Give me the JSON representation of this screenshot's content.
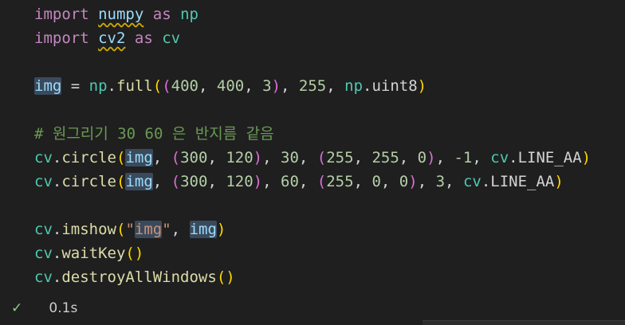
{
  "cell": {
    "lines": [
      [
        [
          "import",
          "kw"
        ],
        [
          " ",
          "op"
        ],
        [
          "numpy",
          "var sq"
        ],
        [
          " ",
          "op"
        ],
        [
          "as",
          "kw"
        ],
        [
          " ",
          "op"
        ],
        [
          "np",
          "mod"
        ]
      ],
      [
        [
          "import",
          "kw"
        ],
        [
          " ",
          "op"
        ],
        [
          "cv2",
          "var sq"
        ],
        [
          " ",
          "op"
        ],
        [
          "as",
          "kw"
        ],
        [
          " ",
          "op"
        ],
        [
          "cv",
          "mod"
        ]
      ],
      [],
      [
        [
          "img",
          "var hl"
        ],
        [
          " = ",
          "op"
        ],
        [
          "np",
          "mod"
        ],
        [
          ".",
          "op"
        ],
        [
          "full",
          "fn"
        ],
        [
          "(",
          "br-gold"
        ],
        [
          "(",
          "br-pink"
        ],
        [
          "400",
          "num"
        ],
        [
          ", ",
          "op"
        ],
        [
          "400",
          "num"
        ],
        [
          ", ",
          "op"
        ],
        [
          "3",
          "num"
        ],
        [
          ")",
          "br-pink"
        ],
        [
          ", ",
          "op"
        ],
        [
          "255",
          "num"
        ],
        [
          ", ",
          "op"
        ],
        [
          "np",
          "mod"
        ],
        [
          ".",
          "op"
        ],
        [
          "uint8",
          "op"
        ],
        [
          ")",
          "br-gold"
        ]
      ],
      [],
      [
        [
          "# 원그리기 30 60 은 반지름 같음",
          "cmt"
        ]
      ],
      [
        [
          "cv",
          "mod"
        ],
        [
          ".",
          "op"
        ],
        [
          "circle",
          "fn"
        ],
        [
          "(",
          "br-gold"
        ],
        [
          "img",
          "var hl"
        ],
        [
          ", ",
          "op"
        ],
        [
          "(",
          "br-pink"
        ],
        [
          "300",
          "num"
        ],
        [
          ", ",
          "op"
        ],
        [
          "120",
          "num"
        ],
        [
          ")",
          "br-pink"
        ],
        [
          ", ",
          "op"
        ],
        [
          "30",
          "num"
        ],
        [
          ", ",
          "op"
        ],
        [
          "(",
          "br-pink"
        ],
        [
          "255",
          "num"
        ],
        [
          ", ",
          "op"
        ],
        [
          "255",
          "num"
        ],
        [
          ", ",
          "op"
        ],
        [
          "0",
          "num"
        ],
        [
          ")",
          "br-pink"
        ],
        [
          ", ",
          "op"
        ],
        [
          "-1",
          "num"
        ],
        [
          ", ",
          "op"
        ],
        [
          "cv",
          "mod"
        ],
        [
          ".",
          "op"
        ],
        [
          "LINE_AA",
          "op"
        ],
        [
          ")",
          "br-gold"
        ]
      ],
      [
        [
          "cv",
          "mod"
        ],
        [
          ".",
          "op"
        ],
        [
          "circle",
          "fn"
        ],
        [
          "(",
          "br-gold"
        ],
        [
          "img",
          "var hl"
        ],
        [
          ", ",
          "op"
        ],
        [
          "(",
          "br-pink"
        ],
        [
          "300",
          "num"
        ],
        [
          ", ",
          "op"
        ],
        [
          "120",
          "num"
        ],
        [
          ")",
          "br-pink"
        ],
        [
          ", ",
          "op"
        ],
        [
          "60",
          "num"
        ],
        [
          ", ",
          "op"
        ],
        [
          "(",
          "br-pink"
        ],
        [
          "255",
          "num"
        ],
        [
          ", ",
          "op"
        ],
        [
          "0",
          "num"
        ],
        [
          ", ",
          "op"
        ],
        [
          "0",
          "num"
        ],
        [
          ")",
          "br-pink"
        ],
        [
          ", ",
          "op"
        ],
        [
          "3",
          "num"
        ],
        [
          ", ",
          "op"
        ],
        [
          "cv",
          "mod"
        ],
        [
          ".",
          "op"
        ],
        [
          "LINE_AA",
          "op"
        ],
        [
          ")",
          "br-gold"
        ]
      ],
      [],
      [
        [
          "cv",
          "mod"
        ],
        [
          ".",
          "op"
        ],
        [
          "imshow",
          "fn"
        ],
        [
          "(",
          "br-gold"
        ],
        [
          "\"",
          "str"
        ],
        [
          "img",
          "str hl"
        ],
        [
          "\"",
          "str"
        ],
        [
          ", ",
          "op"
        ],
        [
          "img",
          "var hl"
        ],
        [
          ")",
          "br-gold"
        ]
      ],
      [
        [
          "cv",
          "mod"
        ],
        [
          ".",
          "op"
        ],
        [
          "waitKey",
          "fn"
        ],
        [
          "()",
          "br-gold"
        ]
      ],
      [
        [
          "cv",
          "mod"
        ],
        [
          ".",
          "op"
        ],
        [
          "destroyAllWindows",
          "fn"
        ],
        [
          "()",
          "br-gold"
        ]
      ]
    ]
  },
  "status": {
    "check_icon": "checkmark-icon",
    "check_glyph": "✓",
    "duration": "0.1s",
    "success_color": "#89d185"
  }
}
